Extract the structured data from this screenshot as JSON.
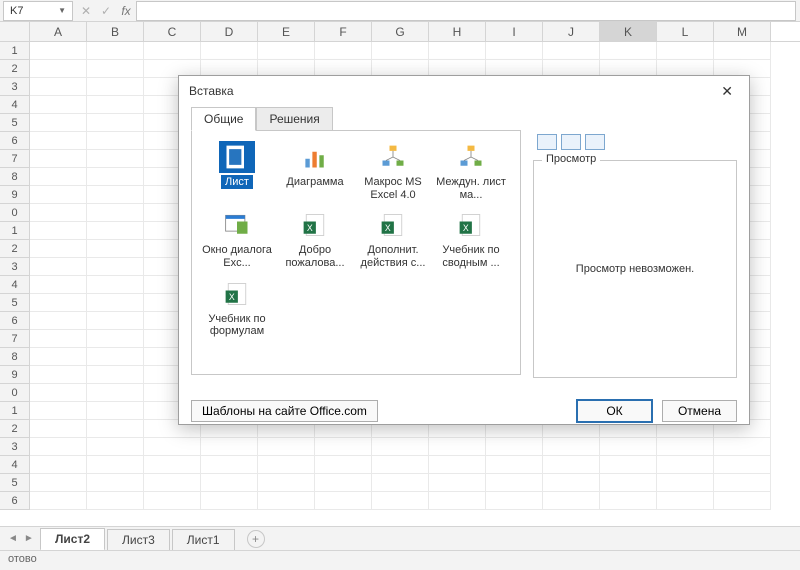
{
  "namebox_value": "K7",
  "columns": [
    "A",
    "B",
    "C",
    "D",
    "E",
    "F",
    "G",
    "H",
    "I",
    "J",
    "K",
    "L",
    "M"
  ],
  "active_column_index": 10,
  "row_start": 1,
  "row_count": 26,
  "sheet_tabs": [
    "Лист2",
    "Лист3",
    "Лист1"
  ],
  "active_sheet_index": 0,
  "status_text": "отово",
  "dialog": {
    "title": "Вставка",
    "tabs": [
      "Общие",
      "Решения"
    ],
    "active_tab_index": 0,
    "items": [
      {
        "label": "Лист",
        "selected": true,
        "icon": "sheet"
      },
      {
        "label": "Диаграмма",
        "icon": "chart"
      },
      {
        "label": "Макрос MS Excel 4.0",
        "icon": "macro"
      },
      {
        "label": "Междун. лист ма...",
        "icon": "intl"
      },
      {
        "label": "Окно диалога Exc...",
        "icon": "dlg"
      },
      {
        "label": "Добро пожалова...",
        "icon": "excel"
      },
      {
        "label": "Дополнит. действия с...",
        "icon": "excel"
      },
      {
        "label": "Учебник по сводным ...",
        "icon": "excel"
      },
      {
        "label": "Учебник по формулам",
        "icon": "excel"
      }
    ],
    "preview_legend": "Просмотр",
    "preview_text": "Просмотр невозможен.",
    "templates_button": "Шаблоны на сайте Office.com",
    "ok_button": "ОК",
    "cancel_button": "Отмена"
  }
}
